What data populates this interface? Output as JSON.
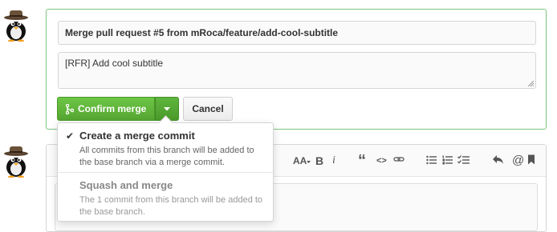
{
  "merge": {
    "commit_title": "Merge pull request #5 from mRoca/feature/add-cool-subtitle",
    "commit_message": "[RFR] Add cool subtitle",
    "confirm_label": "Confirm merge",
    "cancel_label": "Cancel"
  },
  "merge_menu": {
    "items": [
      {
        "title": "Create a merge commit",
        "description": "All commits from this branch will be added to the base branch via a merge commit.",
        "selected": true
      },
      {
        "title": "Squash and merge",
        "description": "The 1 commit from this branch will be added to the base branch.",
        "selected": false
      }
    ]
  },
  "comment_toolbar": {
    "icons": [
      "text-size-icon",
      "bold-icon",
      "italic-icon",
      "quote-icon",
      "code-icon",
      "link-icon",
      "unordered-list-icon",
      "ordered-list-icon",
      "task-list-icon",
      "reply-icon",
      "mention-icon",
      "bookmark-icon"
    ],
    "labels": {
      "text_size": "AA",
      "bold": "B",
      "italic": "i",
      "quote": "“",
      "code": "<>",
      "mention": "@"
    }
  },
  "colors": {
    "merge_green": "#6cc644",
    "merge_border": "#7fc57f"
  }
}
